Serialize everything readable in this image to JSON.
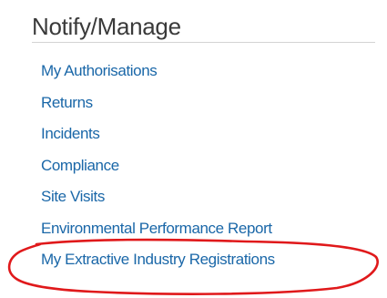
{
  "section": {
    "title": "Notify/Manage"
  },
  "menu": {
    "items": [
      {
        "label": "My Authorisations"
      },
      {
        "label": "Returns"
      },
      {
        "label": "Incidents"
      },
      {
        "label": "Compliance"
      },
      {
        "label": "Site Visits"
      },
      {
        "label": "Environmental Performance Report"
      },
      {
        "label": "My Extractive Industry Registrations"
      }
    ]
  },
  "colors": {
    "link": "#1a67a8",
    "heading": "#3a3a3a",
    "divider": "#d4d4d4",
    "annotation": "#e0191b"
  }
}
